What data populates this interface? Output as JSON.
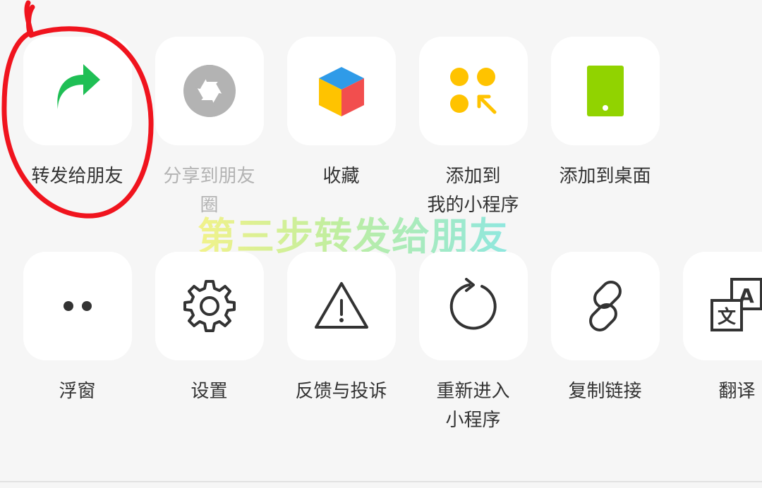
{
  "watermark": "第三步转发给朋友",
  "rows": [
    [
      {
        "label": "转发给朋友",
        "icon": "forward-arrow-icon",
        "color": "#1fbf55",
        "disabled": false
      },
      {
        "label": "分享到朋友\n圈",
        "icon": "moments-aperture-icon",
        "color": "#b3b3b3",
        "disabled": true
      },
      {
        "label": "收藏",
        "icon": "favorites-cube-icon",
        "color": "#2f9be8",
        "disabled": false
      },
      {
        "label": "添加到\n我的小程序",
        "icon": "mini-program-dots-icon",
        "color": "#ffc300",
        "disabled": false
      },
      {
        "label": "添加到桌面",
        "icon": "phone-desktop-icon",
        "color": "#91d300",
        "disabled": false
      }
    ],
    [
      {
        "label": "浮窗",
        "icon": "floating-window-dots-icon",
        "disabled": false
      },
      {
        "label": "设置",
        "icon": "gear-icon",
        "disabled": false
      },
      {
        "label": "反馈与投诉",
        "icon": "warning-triangle-icon",
        "disabled": false
      },
      {
        "label": "重新进入\n小程序",
        "icon": "reload-icon",
        "disabled": false
      },
      {
        "label": "复制链接",
        "icon": "link-icon",
        "disabled": false
      },
      {
        "label": "翻译",
        "icon": "translate-icon",
        "disabled": false
      }
    ]
  ]
}
